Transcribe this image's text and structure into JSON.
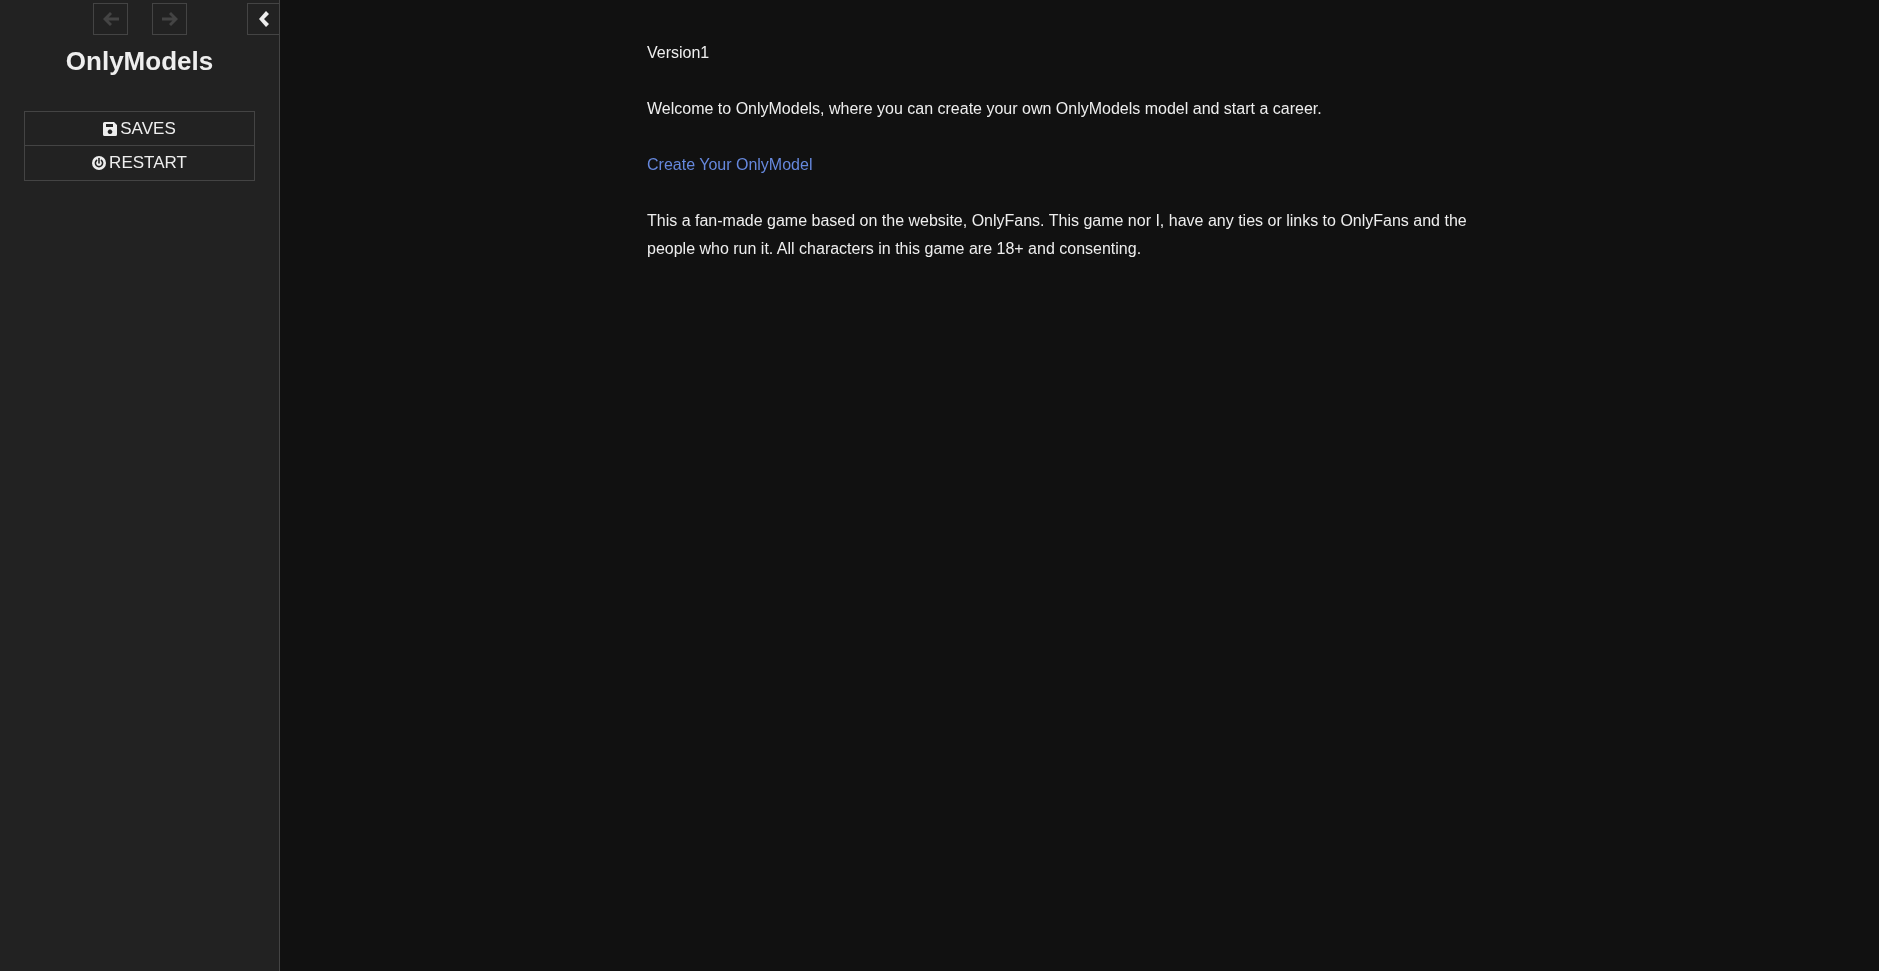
{
  "sidebar": {
    "history": [
      {
        "kind": "back",
        "disabled": true
      },
      {
        "kind": "forward",
        "disabled": true
      }
    ],
    "title": "OnlyModels",
    "menu": [
      {
        "kind": "saves",
        "label": "SAVES"
      },
      {
        "kind": "restart",
        "label": "RESTART"
      }
    ]
  },
  "passage": {
    "version": "Version1",
    "intro": "Welcome to OnlyModels, where you can create your own OnlyModels model and start a career.",
    "link": "Create Your OnlyModel",
    "disclaimer": "This a fan-made game based on the website, OnlyFans. This game nor I, have any ties or links to OnlyFans and the people who run it. All characters in this game are 18+ and consenting."
  }
}
